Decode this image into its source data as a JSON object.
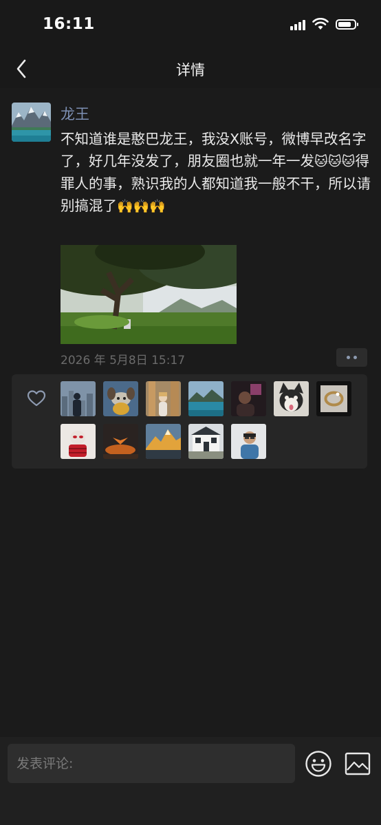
{
  "status": {
    "time": "16:11",
    "battery_level": 0.8
  },
  "nav": {
    "title": "详情"
  },
  "post": {
    "author": "龙王",
    "text_before_emoji": "不知道谁是憨巴龙王，我没X账号，微博早改名字了，好几年没发了，朋友圈也就一年一发",
    "emoji_cat": "🐱",
    "text_middle": "得罪人的事，熟识我的人都知道我一般不干，所以请别搞混了",
    "emoji_hands": "🙌",
    "timestamp": "2026 年 5月8日 15:17"
  },
  "likes": {
    "avatars": [
      "avatar-city-silhouette",
      "avatar-plush-toy",
      "avatar-giraffe-girl",
      "avatar-lake-landscape",
      "avatar-dark-portrait",
      "avatar-husky",
      "avatar-ring",
      "avatar-spiderman-plush",
      "avatar-sunset-bird",
      "avatar-golden-mountain",
      "avatar-house",
      "avatar-man-glasses"
    ]
  },
  "comment": {
    "placeholder": "发表评论:"
  },
  "colors": {
    "background": "#1b1b1b",
    "author_name": "#7d90b4",
    "panel": "#262626",
    "text": "#e9e9e9"
  }
}
